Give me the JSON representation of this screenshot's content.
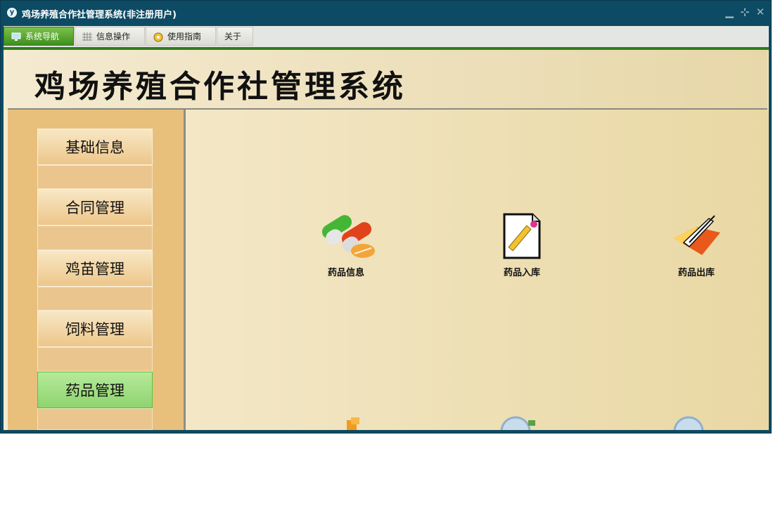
{
  "window": {
    "title": "鸡场养殖合作社管理系统(非注册用户)",
    "app_icon_letter": "y"
  },
  "menubar": {
    "tabs": [
      {
        "label": "系统导航",
        "icon": "monitor-icon",
        "active": true
      },
      {
        "label": "信息操作",
        "icon": "grid-icon",
        "active": false
      },
      {
        "label": "使用指南",
        "icon": "compass-icon",
        "active": false
      },
      {
        "label": "关于",
        "icon": "",
        "active": false
      }
    ]
  },
  "banner": {
    "title": "鸡场养殖合作社管理系统"
  },
  "sidebar": {
    "items": [
      {
        "label": "基础信息",
        "active": false
      },
      {
        "label": "合同管理",
        "active": false
      },
      {
        "label": "鸡苗管理",
        "active": false
      },
      {
        "label": "饲料管理",
        "active": false
      },
      {
        "label": "药品管理",
        "active": true
      }
    ]
  },
  "main": {
    "tiles": [
      {
        "label": "药品信息",
        "icon": "pills-icon"
      },
      {
        "label": "药品入库",
        "icon": "edit-document-icon"
      },
      {
        "label": "药品出库",
        "icon": "folder-pencil-icon"
      }
    ]
  },
  "colors": {
    "titlebar": "#0d4a63",
    "accent_green": "#3f8f1e",
    "sidebar_bg": "#e8c07c",
    "active_item": "#8fd36f"
  }
}
